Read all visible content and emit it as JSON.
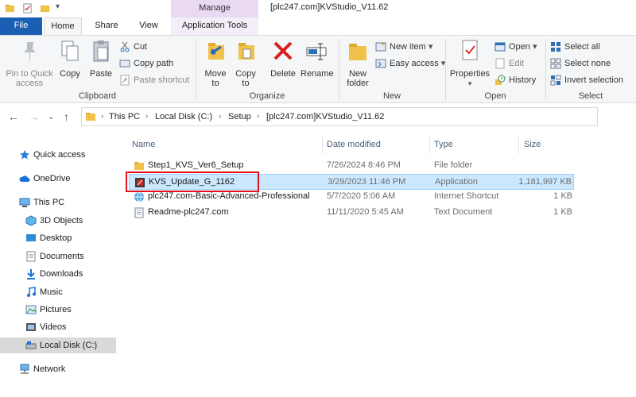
{
  "window": {
    "title": "[plc247.com]KVStudio_V11.62",
    "contextual_header": "Manage"
  },
  "tabs": [
    {
      "label": "File"
    },
    {
      "label": "Home"
    },
    {
      "label": "Share"
    },
    {
      "label": "View"
    },
    {
      "label": "Application Tools"
    }
  ],
  "ribbon": {
    "clipboard": {
      "label": "Clipboard",
      "pin_label": "Pin to Quick access",
      "copy_label": "Copy",
      "paste_label": "Paste",
      "cut_label": "Cut",
      "copy_path_label": "Copy path",
      "paste_shortcut_label": "Paste shortcut"
    },
    "organize": {
      "label": "Organize",
      "move_to_label": "Move to",
      "copy_to_label": "Copy to",
      "delete_label": "Delete",
      "rename_label": "Rename"
    },
    "new": {
      "label": "New",
      "new_folder_label": "New folder",
      "new_item_label": "New item",
      "easy_access_label": "Easy access"
    },
    "open": {
      "label": "Open",
      "properties_label": "Properties",
      "open_label": "Open",
      "edit_label": "Edit",
      "history_label": "History"
    },
    "select": {
      "label": "Select",
      "select_all_label": "Select all",
      "select_none_label": "Select none",
      "invert_label": "Invert selection"
    }
  },
  "address": {
    "crumbs": [
      "This PC",
      "Local Disk (C:)",
      "Setup",
      "[plc247.com]KVStudio_V11.62"
    ]
  },
  "nav_pane": {
    "items": [
      {
        "label": "Quick access"
      },
      {
        "label": "OneDrive"
      },
      {
        "label": "This PC"
      },
      {
        "label": "3D Objects"
      },
      {
        "label": "Desktop"
      },
      {
        "label": "Documents"
      },
      {
        "label": "Downloads"
      },
      {
        "label": "Music"
      },
      {
        "label": "Pictures"
      },
      {
        "label": "Videos"
      },
      {
        "label": "Local Disk (C:)"
      },
      {
        "label": "Network"
      }
    ]
  },
  "file_list": {
    "columns": [
      "Name",
      "Date modified",
      "Type",
      "Size"
    ],
    "rows": [
      {
        "name": "Step1_KVS_Ver6_Setup",
        "date": "7/26/2024 8:46 PM",
        "type": "File folder",
        "size": "",
        "icon": "folder-icon"
      },
      {
        "name": "KVS_Update_G_1162",
        "date": "3/29/2023 11:46 PM",
        "type": "Application",
        "size": "1,181,997 KB",
        "icon": "application-icon"
      },
      {
        "name": "plc247.com-Basic-Advanced-Professional",
        "date": "5/7/2020 5:06 AM",
        "type": "Internet Shortcut",
        "size": "1 KB",
        "icon": "internet-shortcut-icon"
      },
      {
        "name": "Readme-plc247.com",
        "date": "11/11/2020 5:45 AM",
        "type": "Text Document",
        "size": "1 KB",
        "icon": "text-document-icon"
      }
    ]
  },
  "colors": {
    "file_tab": "#1a5fb4",
    "manage_header": "#e9d9f3",
    "selected_row": "#cce8ff",
    "highlight_box": "#e0101c",
    "folder": "#f0c24b"
  }
}
